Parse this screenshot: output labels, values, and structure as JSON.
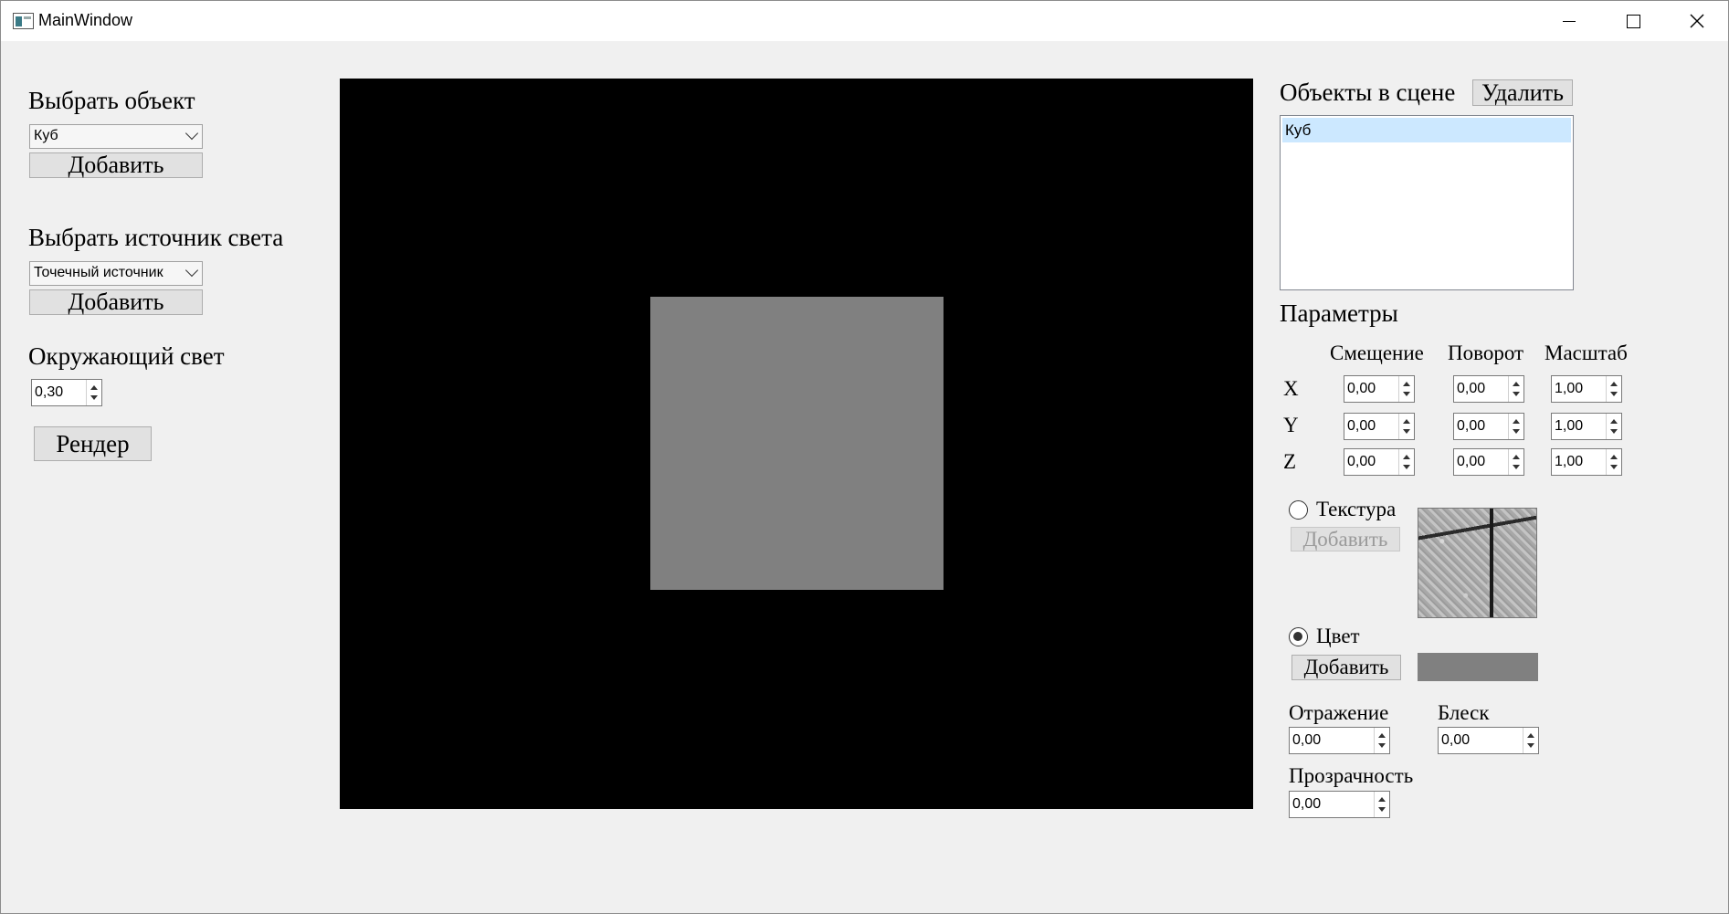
{
  "window": {
    "title": "MainWindow"
  },
  "left_panel": {
    "object_title": "Выбрать объект",
    "object_combo_value": "Куб",
    "object_add_label": "Добавить",
    "light_title": "Выбрать источник света",
    "light_combo_value": "Точечный источник",
    "light_add_label": "Добавить",
    "ambient_title": "Окружающий свет",
    "ambient_value": "0,30",
    "render_label": "Рендер"
  },
  "scene": {
    "title": "Объекты в сцене",
    "delete_label": "Удалить",
    "objects": [
      "Куб"
    ]
  },
  "params": {
    "title": "Параметры",
    "col_offset": "Смещение",
    "col_rotation": "Поворот",
    "col_scale": "Масштаб",
    "rows": [
      {
        "axis": "X",
        "offset": "0,00",
        "rotation": "0,00",
        "scale": "1,00"
      },
      {
        "axis": "Y",
        "offset": "0,00",
        "rotation": "0,00",
        "scale": "1,00"
      },
      {
        "axis": "Z",
        "offset": "0,00",
        "rotation": "0,00",
        "scale": "1,00"
      }
    ],
    "texture_label": "Текстура",
    "texture_add_label": "Добавить",
    "color_label": "Цвет",
    "color_add_label": "Добавить",
    "color_value": "#808080",
    "reflection_label": "Отражение",
    "reflection_value": "0,00",
    "shine_label": "Блеск",
    "shine_value": "0,00",
    "transparency_label": "Прозрачность",
    "transparency_value": "0,00"
  }
}
